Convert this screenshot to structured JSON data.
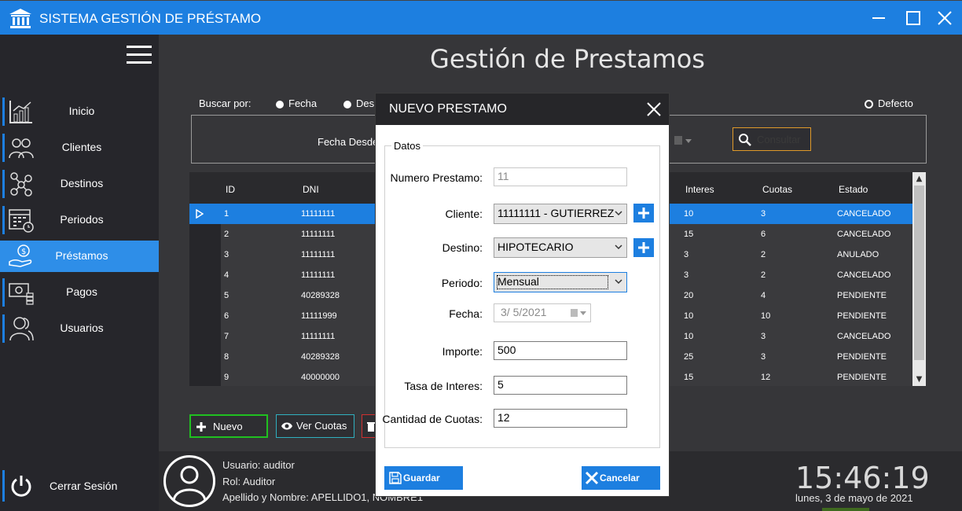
{
  "window": {
    "title": "SISTEMA GESTIÓN DE PRÉSTAMO"
  },
  "sidebar": {
    "items": [
      {
        "label": "Inicio",
        "icon": "chart-icon"
      },
      {
        "label": "Clientes",
        "icon": "users-icon"
      },
      {
        "label": "Destinos",
        "icon": "network-icon"
      },
      {
        "label": "Periodos",
        "icon": "calendar-icon"
      },
      {
        "label": "Préstamos",
        "icon": "money-hand-icon"
      },
      {
        "label": "Pagos",
        "icon": "cash-icon"
      },
      {
        "label": "Usuarios",
        "icon": "user-group-icon"
      }
    ],
    "logout_label": "Cerrar Sesión"
  },
  "main": {
    "title": "Gestión de Prestamos",
    "search_by_label": "Buscar por:",
    "radio_fecha": "Fecha",
    "radio_partial": "Des",
    "radio_defecto": "Defecto",
    "fecha_desde_label": "Fecha Desde",
    "consultar_label": "Consultar"
  },
  "grid": {
    "headers": {
      "id": "ID",
      "dni": "DNI",
      "interes": "Interes",
      "cuotas": "Cuotas",
      "estado": "Estado"
    },
    "rows": [
      {
        "id": "1",
        "dni": "11111111",
        "interes": "10",
        "cuotas": "3",
        "estado": "CANCELADO"
      },
      {
        "id": "2",
        "dni": "11111111",
        "interes": "15",
        "cuotas": "6",
        "estado": "CANCELADO"
      },
      {
        "id": "3",
        "dni": "11111111",
        "interes": "3",
        "cuotas": "2",
        "estado": "ANULADO"
      },
      {
        "id": "4",
        "dni": "11111111",
        "interes": "3",
        "cuotas": "2",
        "estado": "CANCELADO"
      },
      {
        "id": "5",
        "dni": "40289328",
        "interes": "20",
        "cuotas": "4",
        "estado": "PENDIENTE"
      },
      {
        "id": "6",
        "dni": "11111999",
        "interes": "10",
        "cuotas": "10",
        "estado": "PENDIENTE"
      },
      {
        "id": "7",
        "dni": "11111111",
        "interes": "10",
        "cuotas": "3",
        "estado": "CANCELADO"
      },
      {
        "id": "8",
        "dni": "40289328",
        "interes": "25",
        "cuotas": "3",
        "estado": "PENDIENTE"
      },
      {
        "id": "9",
        "dni": "40000000",
        "interes": "15",
        "cuotas": "12",
        "estado": "PENDIENTE"
      }
    ]
  },
  "actions": {
    "nuevo": "Nuevo",
    "ver_cuotas": "Ver Cuotas"
  },
  "footer": {
    "usuario": "Usuario: auditor",
    "rol": "Rol: Auditor",
    "nombre": "Apellido y Nombre: APELLIDO1, NOMBRE1",
    "time": "15:46:19",
    "date": "lunes, 3 de mayo de 2021"
  },
  "modal": {
    "title": "NUEVO PRESTAMO",
    "legend": "Datos",
    "numero_label": "Numero Prestamo:",
    "numero_value": "11",
    "cliente_label": "Cliente:",
    "cliente_value": "11111111 - GUTIERREZ",
    "destino_label": "Destino:",
    "destino_value": "HIPOTECARIO",
    "periodo_label": "Periodo:",
    "periodo_value": "Mensual",
    "fecha_label": "Fecha:",
    "fecha_value": "3/  5/2021",
    "importe_label": "Importe:",
    "importe_value": "500",
    "tasa_label": "Tasa de Interes:",
    "tasa_value": "5",
    "cantidad_label": "Cantidad de Cuotas:",
    "cantidad_value": "12",
    "guardar": "Guardar",
    "cancelar": "Cancelar"
  },
  "colors": {
    "accent": "#1d7fe0",
    "sidebar_bg": "#26262b",
    "main_bg": "#363639"
  }
}
